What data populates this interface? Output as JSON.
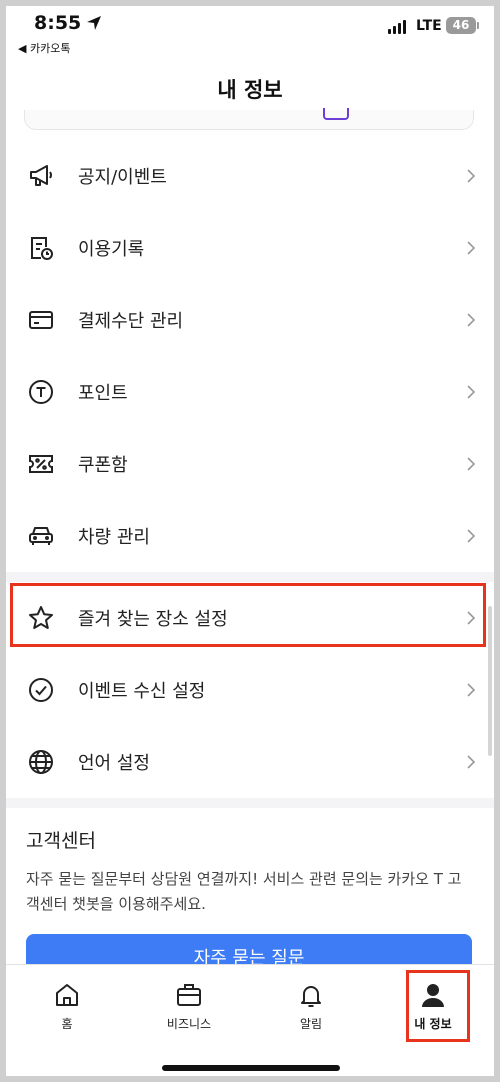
{
  "status_bar": {
    "time": "8:55",
    "back_app": "◀ 카카오톡",
    "network": "LTE",
    "battery": "46"
  },
  "header": {
    "title": "내 정보"
  },
  "menu": {
    "items": [
      {
        "label": "공지/이벤트",
        "icon": "megaphone-icon"
      },
      {
        "label": "이용기록",
        "icon": "history-document-icon"
      },
      {
        "label": "결제수단 관리",
        "icon": "credit-card-icon"
      },
      {
        "label": "포인트",
        "icon": "point-coin-icon"
      },
      {
        "label": "쿠폰함",
        "icon": "coupon-icon"
      },
      {
        "label": "차량 관리",
        "icon": "car-icon"
      }
    ],
    "settings": [
      {
        "label": "즐겨 찾는 장소 설정",
        "icon": "star-icon"
      },
      {
        "label": "이벤트 수신 설정",
        "icon": "check-circle-icon"
      },
      {
        "label": "언어 설정",
        "icon": "globe-icon"
      }
    ]
  },
  "support": {
    "title": "고객센터",
    "description": "자주 묻는 질문부터 상담원 연결까지! 서비스 관련 문의는 카카오 T 고객센터 챗봇을 이용해주세요.",
    "faq_button": "자주 묻는 질문"
  },
  "tab_bar": {
    "tabs": [
      {
        "label": "홈",
        "icon": "home-icon"
      },
      {
        "label": "비즈니스",
        "icon": "briefcase-icon"
      },
      {
        "label": "알림",
        "icon": "bell-icon"
      },
      {
        "label": "내 정보",
        "icon": "profile-icon",
        "active": true
      }
    ]
  },
  "colors": {
    "accent": "#3d7cf4",
    "highlight": "#e8341c",
    "purple": "#6b3fd6"
  }
}
